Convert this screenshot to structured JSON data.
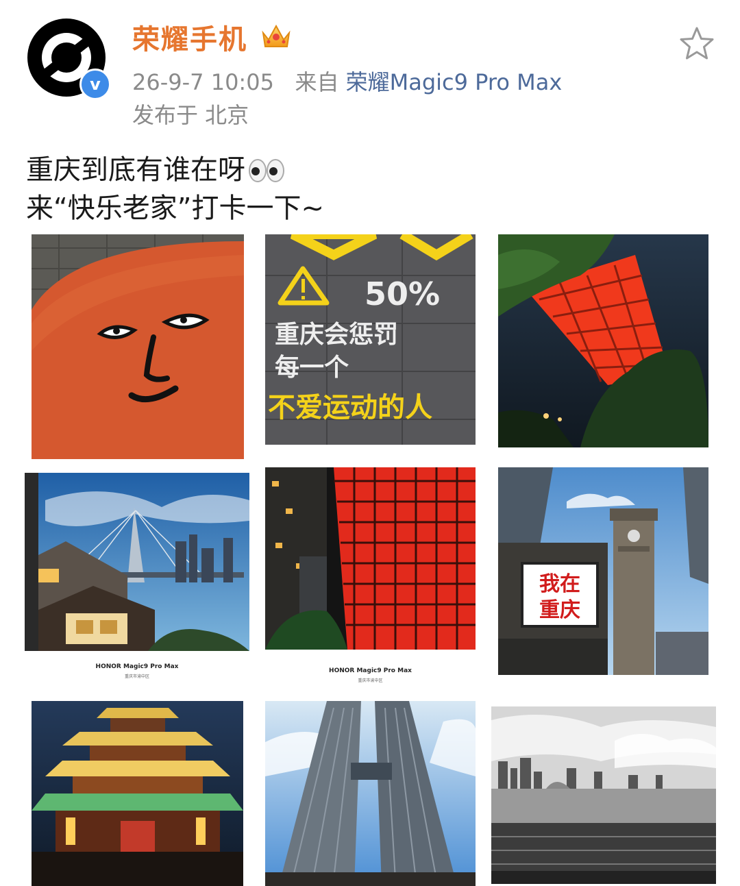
{
  "post": {
    "author": "荣耀手机",
    "crown_icon": "crown-icon",
    "verified_icon": "verified-icon",
    "verified_mark": "v",
    "timestamp": "26-9-7 10:05",
    "from_label": "来自",
    "source": "荣耀Magic9 Pro Max",
    "location": "发布于 北京",
    "favorite_icon": "star-icon",
    "text_line1": "重庆到底有谁在呀",
    "text_line2": "来“快乐老家”打卡一下~",
    "emoji_icon": "eyes-icon"
  },
  "photos": [
    {
      "subject": "orange-round-wall-face-painting",
      "text": ""
    },
    {
      "subject": "street-slogan",
      "text": "50%",
      "lines": [
        "重庆会惩罚",
        "每一个",
        "不爱运动的人"
      ]
    },
    {
      "subject": "red-bridge-night",
      "text": ""
    },
    {
      "subject": "bridge-old-house-dusk",
      "caption": "HONOR Magic9 Pro Max",
      "subcaption": "重庆市渝中区"
    },
    {
      "subject": "red-steel-grid-night",
      "caption": "HONOR Magic9 Pro Max",
      "subcaption": "重庆市渝中区"
    },
    {
      "subject": "liberation-monument-billboard",
      "billboard": [
        "我在",
        "重庆"
      ]
    },
    {
      "subject": "pavilion-lit-night",
      "text": ""
    },
    {
      "subject": "twin-towers-skybridge",
      "text": ""
    },
    {
      "subject": "bw-river-skyline",
      "text": ""
    }
  ],
  "colors": {
    "author": "#e6762f",
    "meta": "#8a8a8a",
    "source_link": "#4d6a9a",
    "verified": "#3d8be8",
    "slogan_yellow": "#f4d21a"
  }
}
